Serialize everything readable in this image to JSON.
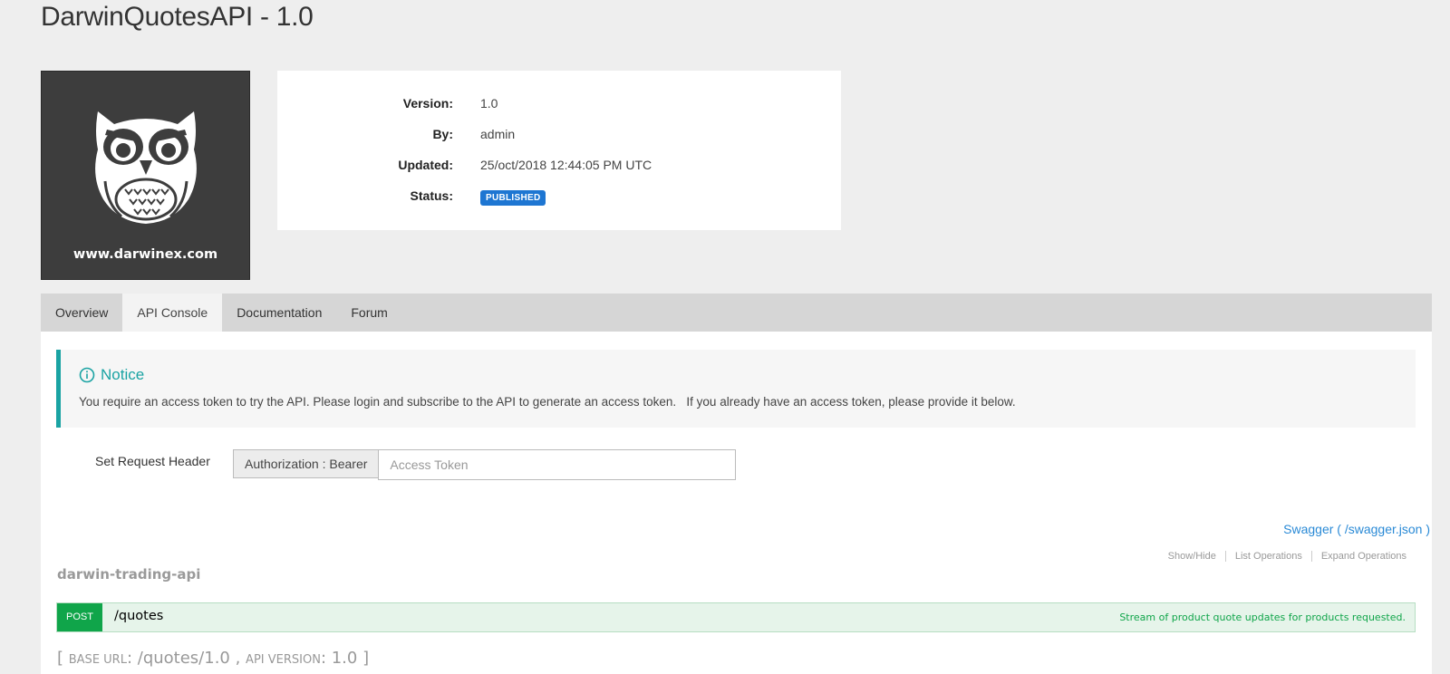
{
  "page": {
    "title": "DarwinQuotesAPI - 1.0"
  },
  "thumbnail": {
    "site_text": "www.darwinex.com",
    "icon": "owl-logo",
    "bg_color": "#3d3d3d"
  },
  "info": {
    "version_label": "Version:",
    "version_value": "1.0",
    "by_label": "By:",
    "by_value": "admin",
    "updated_label": "Updated:",
    "updated_value": "25/oct/2018 12:44:05 PM UTC",
    "status_label": "Status:",
    "status_value": "PUBLISHED",
    "status_color": "#1e76d2"
  },
  "tabs": [
    {
      "label": "Overview",
      "active": false
    },
    {
      "label": "API Console",
      "active": true
    },
    {
      "label": "Documentation",
      "active": false
    },
    {
      "label": "Forum",
      "active": false
    }
  ],
  "notice": {
    "icon": "info-circle-icon",
    "title": "Notice",
    "message": "You require an access token to try the API. Please login and subscribe to the API to generate an access token.   If you already have an access token, please provide it below.",
    "accent_color": "#1aa3a3"
  },
  "request_header": {
    "label": "Set Request Header",
    "addon": "Authorization : Bearer",
    "placeholder": "Access Token",
    "value": ""
  },
  "swagger": {
    "link_text": "Swagger ( /swagger.json )"
  },
  "api": {
    "name": "darwin-trading-api",
    "ops": [
      "Show/Hide",
      "List Operations",
      "Expand Operations"
    ],
    "endpoints": [
      {
        "method": "POST",
        "path": "/quotes",
        "description": "Stream of product quote updates for products requested.",
        "method_color": "#10a54a"
      }
    ],
    "base_url_label": "BASE URL",
    "base_url_value": "/quotes/1.0",
    "api_version_label": "API VERSION",
    "api_version_value": "1.0"
  }
}
